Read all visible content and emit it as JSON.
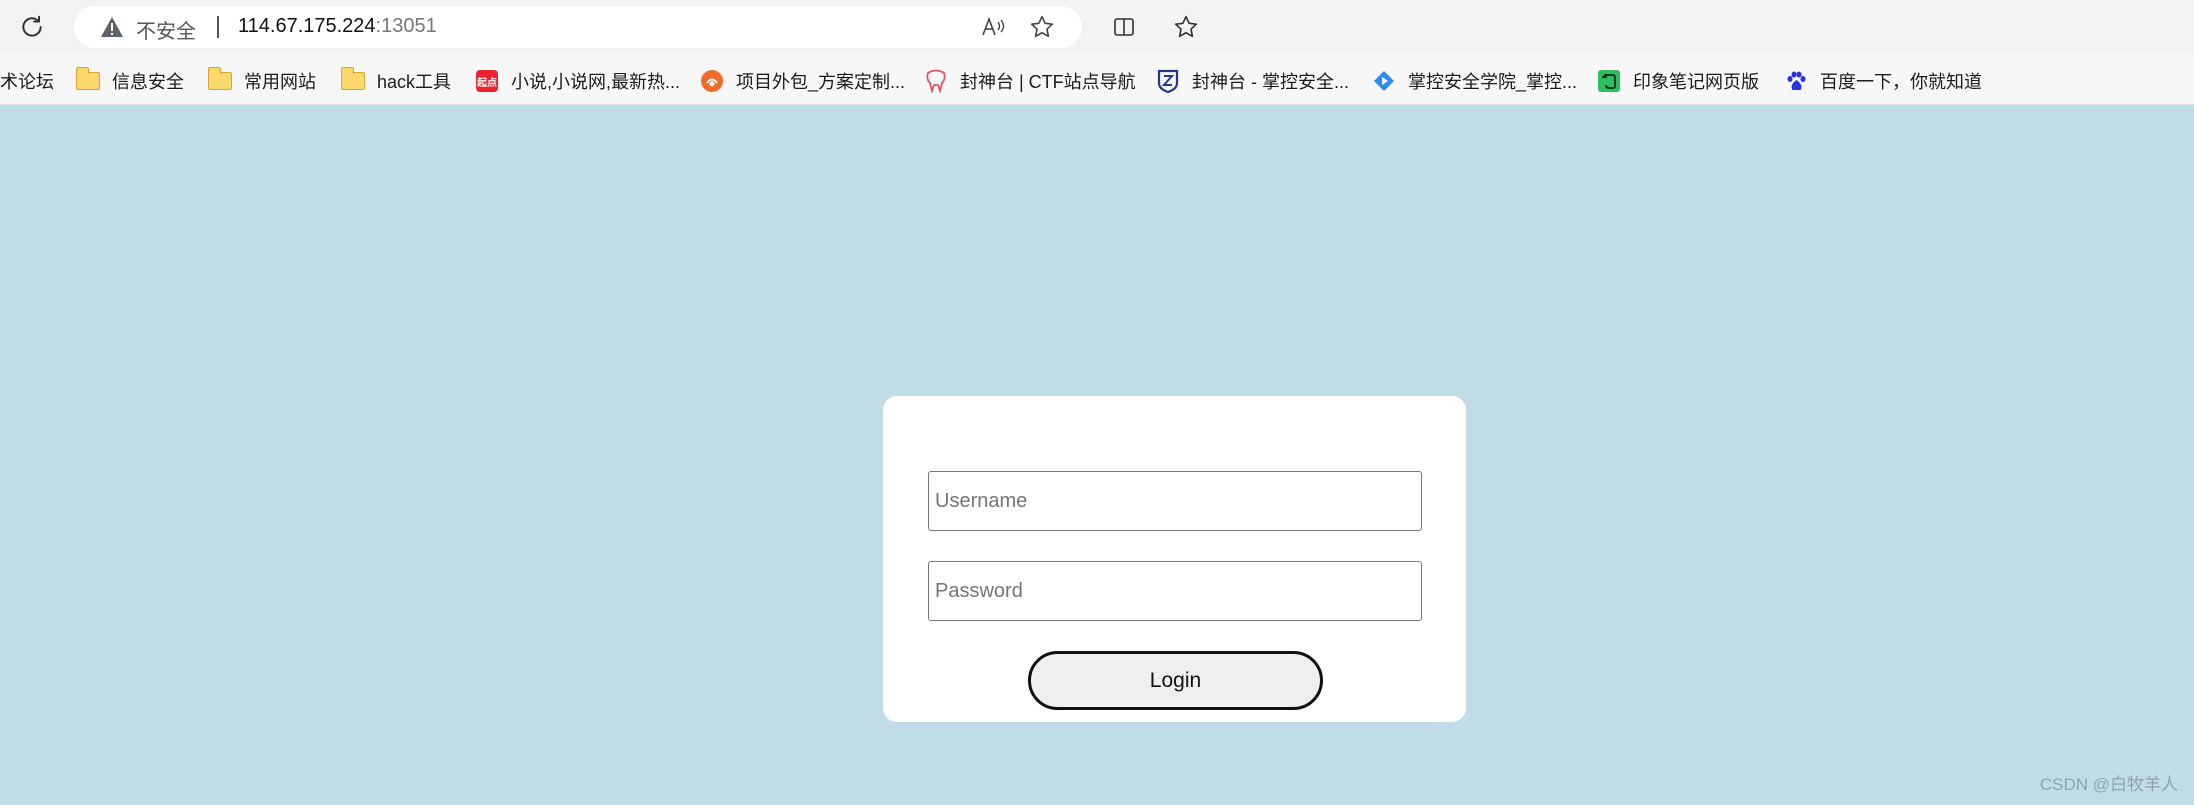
{
  "browser": {
    "security_label": "不安全",
    "url_host": "114.67.175.224",
    "url_port": ":13051"
  },
  "bookmarks": [
    {
      "label": "术论坛",
      "icon": "none"
    },
    {
      "label": "信息安全",
      "icon": "folder-icon"
    },
    {
      "label": "常用网站",
      "icon": "folder-icon"
    },
    {
      "label": "hack工具",
      "icon": "folder-icon"
    },
    {
      "label": "小说,小说网,最新热...",
      "icon": "qidian-icon",
      "badge_text": "起点",
      "color": "#e8232f"
    },
    {
      "label": "项目外包_方案定制...",
      "icon": "orange-circle-icon",
      "color": "#ef6b2a"
    },
    {
      "label": "封神台 | CTF站点导航",
      "icon": "tooth-icon",
      "color": "#e05565"
    },
    {
      "label": "封神台 - 掌控安全...",
      "icon": "shield-icon",
      "color": "#1f3a8a"
    },
    {
      "label": "掌控安全学院_掌控...",
      "icon": "diamond-icon",
      "color": "#2b8de8"
    },
    {
      "label": "印象笔记网页版",
      "icon": "evernote-icon",
      "color": "#2dbe60"
    },
    {
      "label": "百度一下，你就知道",
      "icon": "baidu-paw-icon",
      "color": "#2932e1"
    }
  ],
  "login": {
    "username_placeholder": "Username",
    "password_placeholder": "Password",
    "button_label": "Login"
  },
  "watermark": "CSDN @白牧羊人"
}
